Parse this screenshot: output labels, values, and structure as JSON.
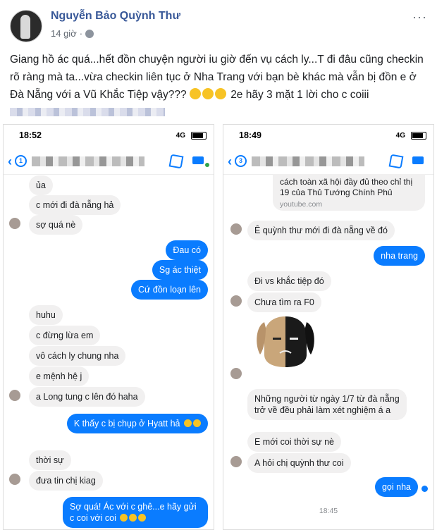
{
  "post": {
    "author": "Nguyễn Bảo Quỳnh Thư",
    "time": "14 giờ",
    "more": "···",
    "text": "Giang hồ ác quá...hết đồn chuyện người iu giờ đến vụ cách ly...T đi đâu cũng checkin rõ ràng mà ta...vừa checkin liên tục ở Nha Trang với bạn bè khác mà vẫn bị đồn e ở Đà Nẵng với a Vũ Khắc Tiệp vậy???",
    "text_tail": "2e hãy 3 mặt 1 lời cho c coiii"
  },
  "left_phone": {
    "time": "18:52",
    "signal": "4G",
    "back_badge": "1",
    "messages": [
      {
        "text": "ủa",
        "side": "in"
      },
      {
        "text": "c mới đi đà nẵng hả",
        "side": "in"
      },
      {
        "text": "sợ quá nè",
        "side": "in"
      },
      {
        "text": "Đau có",
        "side": "out"
      },
      {
        "text": "Sg ác thiệt",
        "side": "out"
      },
      {
        "text": "Cứ đồn loạn lên",
        "side": "out"
      },
      {
        "text": "huhu",
        "side": "in"
      },
      {
        "text": "c đừng lừa em",
        "side": "in"
      },
      {
        "text": "vô cách ly chung nha",
        "side": "in"
      },
      {
        "text": "e mệnh hệ j",
        "side": "in"
      },
      {
        "text": "a Long tung c lên đó haha",
        "side": "in"
      },
      {
        "text": "K thấy c bị chụp ở Hyatt hả",
        "side": "out"
      },
      {
        "text": "thời sự",
        "side": "in"
      },
      {
        "text": "đưa tin chị kiag",
        "side": "in"
      },
      {
        "text": "Sợ quá! Ác với c ghê...e hãy gửi c coi với coi",
        "side": "out"
      }
    ]
  },
  "right_phone": {
    "time": "18:49",
    "signal": "4G",
    "back_badge": "3",
    "link_card": {
      "text": "cách toàn xã hội đầy đủ theo chỉ thị 19 của Thủ Tướng Chính Phủ",
      "domain": "youtube.com"
    },
    "messages": [
      {
        "text": "Ê quỳnh thư mới đi đà nẵng về đó",
        "side": "in"
      },
      {
        "text": "nha trang",
        "side": "out"
      },
      {
        "text": "Đi vs khắc tiệp đó",
        "side": "in"
      },
      {
        "text": "Chưa tìm ra F0",
        "side": "in"
      },
      {
        "text": "Những người từ ngày 1/7 từ đà nẵng trở về đều phải làm xét nghiệm á a",
        "side": "in"
      },
      {
        "text": "E mới coi thời sự nè",
        "side": "in"
      },
      {
        "text": "A hỏi chị quỳnh thư coi",
        "side": "in"
      },
      {
        "text": "gọi nha",
        "side": "out"
      }
    ],
    "timestamp": "18:45"
  },
  "colors": {
    "messenger_blue": "#0a7cff",
    "bubble_gray": "#f1f0f0",
    "fb_name": "#385898"
  },
  "icons": [
    "back-arrow-icon",
    "phone-call-icon",
    "video-call-icon",
    "globe-icon",
    "laughing-emoji-icon"
  ]
}
